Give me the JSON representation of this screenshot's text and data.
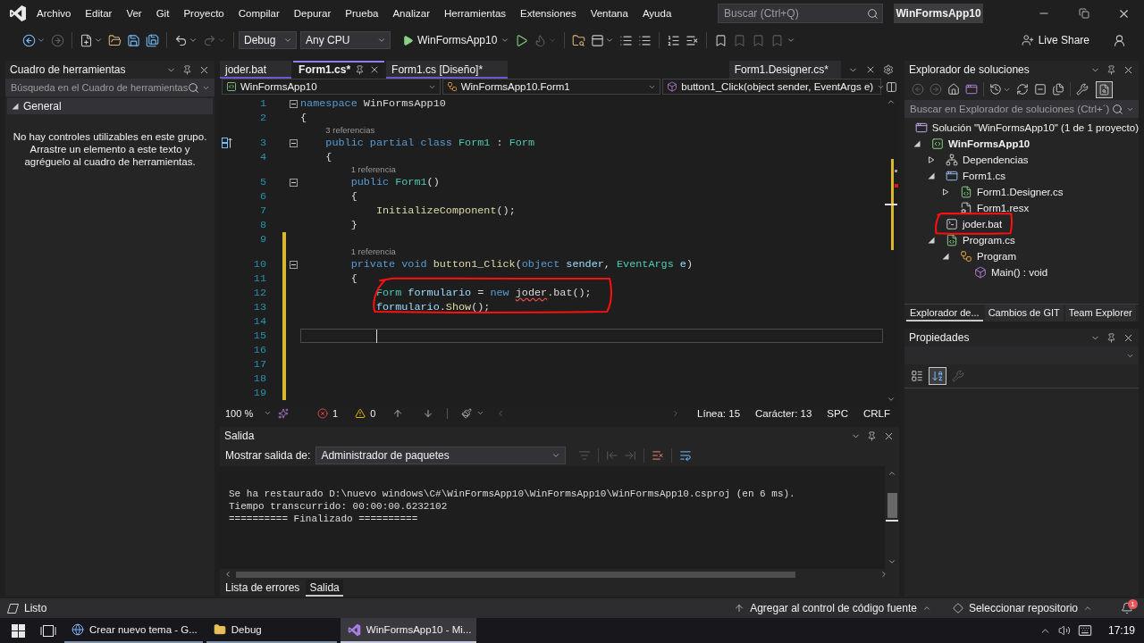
{
  "menu_bar": {
    "items": [
      "Archivo",
      "Editar",
      "Ver",
      "Git",
      "Proyecto",
      "Compilar",
      "Depurar",
      "Prueba",
      "Analizar",
      "Herramientas",
      "Extensiones",
      "Ventana",
      "Ayuda"
    ],
    "search": {
      "placeholder": "Buscar (Ctrl+Q)"
    },
    "solution_name": "WinFormsApp10"
  },
  "toolbar": {
    "items": [
      {
        "kind": "back",
        "disabled": false
      },
      {
        "kind": "forward",
        "disabled": true
      },
      {
        "kind": "separator"
      },
      {
        "kind": "new_item",
        "disabled": false
      },
      {
        "kind": "open",
        "disabled": false
      },
      {
        "kind": "save",
        "disabled": false
      },
      {
        "kind": "save_all",
        "disabled": false
      },
      {
        "kind": "separator"
      },
      {
        "kind": "undo",
        "disabled": false
      },
      {
        "kind": "redo",
        "disabled": true
      },
      {
        "kind": "separator"
      },
      {
        "kind": "dropdown",
        "label": "Debug"
      },
      {
        "kind": "dropdown",
        "label": "Any CPU"
      },
      {
        "kind": "start",
        "label": "WinFormsApp10"
      },
      {
        "kind": "run",
        "disabled": false
      },
      {
        "kind": "hot_reload",
        "disabled": true
      },
      {
        "kind": "separator"
      },
      {
        "kind": "folder_search",
        "disabled": false
      },
      {
        "kind": "layout",
        "disabled": false
      },
      {
        "kind": "align",
        "disabled": false
      },
      {
        "kind": "align",
        "disabled": false
      },
      {
        "kind": "separator"
      },
      {
        "kind": "comment",
        "disabled": false
      },
      {
        "kind": "uncomment",
        "disabled": false
      },
      {
        "kind": "separator"
      },
      {
        "kind": "bookmark",
        "disabled": false
      },
      {
        "kind": "bookmark",
        "disabled": true
      },
      {
        "kind": "bookmark",
        "disabled": true
      },
      {
        "kind": "bookmark",
        "disabled": true
      }
    ],
    "live_share": "Live Share"
  },
  "toolbox": {
    "title": "Cuadro de herramientas",
    "search": {
      "placeholder": "Búsqueda en el Cuadro de herramientas"
    },
    "groups": [
      {
        "label": "General",
        "expanded": true,
        "message": "No hay controles utilizables en este grupo. Arrastre un elemento a este texto y agréguelo al cuadro de herramientas."
      }
    ]
  },
  "editor": {
    "tabs": [
      {
        "label": "joder.bat",
        "selected": false
      },
      {
        "label": "Form1.cs*",
        "selected": true
      },
      {
        "label": "Form1.cs [Diseño]*",
        "selected": false
      }
    ],
    "preview_tab": {
      "label": "Form1.Designer.cs*"
    },
    "navigation": [
      {
        "kind": "project",
        "label": "WinFormsApp10"
      },
      {
        "kind": "class",
        "label": "WinFormsApp10.Form1"
      },
      {
        "kind": "method",
        "label": "button1_Click(object sender, EventArgs e)"
      }
    ],
    "lines": [
      {
        "number": "1",
        "kind": "namespace",
        "tokens": [
          {
            "text": "namespace",
            "kind": "keyword"
          },
          {
            "text": " WinFormsApp10",
            "kind": "plain"
          }
        ],
        "changed": false,
        "current": false,
        "circled": false
      },
      {
        "number": "2",
        "kind": "line",
        "tokens": [
          {
            "text": "{",
            "kind": "plain"
          }
        ],
        "changed": false,
        "current": false,
        "circled": false,
        "children": [
          {
            "number": "3",
            "kind": "class",
            "codelens": "3 referencias",
            "tokens": [
              {
                "text": "public partial class ",
                "kind": "keyword"
              },
              {
                "text": "Form1",
                "kind": "type"
              },
              {
                "text": " : ",
                "kind": "plain"
              },
              {
                "text": "Form",
                "kind": "type"
              }
            ],
            "changed": false,
            "current": false,
            "circled": false
          },
          {
            "number": "4",
            "kind": "line",
            "tokens": [
              {
                "text": "{",
                "kind": "plain"
              }
            ],
            "changed": false,
            "current": false,
            "circled": false,
            "children": [
              {
                "number": "5",
                "kind": "member",
                "codelens": "1 referencia",
                "tokens": [
                  {
                    "text": "public ",
                    "kind": "keyword"
                  },
                  {
                    "text": "Form1",
                    "kind": "type"
                  },
                  {
                    "text": "()",
                    "kind": "plain"
                  }
                ],
                "changed": false,
                "current": false,
                "circled": false
              },
              {
                "number": "6",
                "kind": "line",
                "tokens": [
                  {
                    "text": "{",
                    "kind": "plain"
                  }
                ],
                "changed": false,
                "current": false,
                "circled": false,
                "children": [
                  {
                    "number": "7",
                    "kind": "line",
                    "tokens": [
                      {
                        "text": "InitializeComponent",
                        "kind": "method"
                      },
                      {
                        "text": "();",
                        "kind": "plain"
                      }
                    ],
                    "changed": false,
                    "current": false,
                    "circled": false
                  }
                ]
              },
              {
                "number": "8",
                "kind": "line",
                "tokens": [
                  {
                    "text": "}",
                    "kind": "plain"
                  }
                ],
                "changed": false,
                "current": false,
                "circled": false
              },
              {
                "number": "9",
                "kind": "line",
                "changed": true,
                "current": false,
                "circled": false
              },
              {
                "number": "10",
                "kind": "member",
                "codelens": "1 referencia",
                "tokens": [
                  {
                    "text": "private void ",
                    "kind": "keyword"
                  },
                  {
                    "text": "button1_Click",
                    "kind": "method"
                  },
                  {
                    "text": "(",
                    "kind": "plain"
                  },
                  {
                    "text": "object",
                    "kind": "keyword"
                  },
                  {
                    "text": " sender",
                    "kind": "param"
                  },
                  {
                    "text": ", ",
                    "kind": "plain"
                  },
                  {
                    "text": "EventArgs",
                    "kind": "type"
                  },
                  {
                    "text": " e",
                    "kind": "param"
                  },
                  {
                    "text": ")",
                    "kind": "plain"
                  }
                ],
                "changed": true,
                "current": false,
                "circled": false
              },
              {
                "number": "11",
                "kind": "line",
                "tokens": [
                  {
                    "text": "{",
                    "kind": "plain"
                  }
                ],
                "changed": true,
                "current": false,
                "circled": false,
                "children": [
                  {
                    "number": "12",
                    "kind": "line",
                    "tokens": [
                      {
                        "text": "Form",
                        "kind": "type"
                      },
                      {
                        "text": " formulario",
                        "kind": "param"
                      },
                      {
                        "text": " = ",
                        "kind": "plain"
                      },
                      {
                        "text": "new ",
                        "kind": "keyword"
                      },
                      {
                        "text": "joder",
                        "kind": "unresolved"
                      },
                      {
                        "text": ".bat();",
                        "kind": "plain"
                      }
                    ],
                    "changed": true,
                    "current": false,
                    "circled": true
                  },
                  {
                    "number": "13",
                    "kind": "line",
                    "tokens": [
                      {
                        "text": "formulario",
                        "kind": "param"
                      },
                      {
                        "text": ".",
                        "kind": "plain"
                      },
                      {
                        "text": "Show",
                        "kind": "method"
                      },
                      {
                        "text": "();",
                        "kind": "plain"
                      }
                    ],
                    "changed": true,
                    "current": false,
                    "circled": true
                  },
                  {
                    "number": "14",
                    "kind": "line",
                    "changed": true,
                    "current": false,
                    "circled": false
                  },
                  {
                    "number": "15",
                    "kind": "line",
                    "changed": true,
                    "current": true,
                    "circled": false
                  },
                  {
                    "number": "16",
                    "kind": "line",
                    "changed": true,
                    "current": false,
                    "circled": false
                  },
                  {
                    "number": "17",
                    "kind": "line",
                    "changed": true,
                    "current": false,
                    "circled": false
                  },
                  {
                    "number": "18",
                    "kind": "line",
                    "changed": true,
                    "current": false,
                    "circled": false
                  },
                  {
                    "number": "19",
                    "kind": "line",
                    "changed": true,
                    "current": false,
                    "circled": false
                  }
                ]
              }
            ]
          }
        ]
      }
    ],
    "status": {
      "zoom": "100 %",
      "errors": "1",
      "warnings": "0",
      "line": "Línea: 15",
      "column": "Carácter: 13",
      "whitespace": "SPC",
      "line_ending": "CRLF"
    }
  },
  "output": {
    "title": "Salida",
    "source_label": "Mostrar salida de:",
    "source": "Administrador de paquetes",
    "toolbar": [
      {
        "kind": "find",
        "disabled": true
      },
      {
        "kind": "separator"
      },
      {
        "kind": "previous",
        "disabled": true
      },
      {
        "kind": "next",
        "disabled": true
      },
      {
        "kind": "separator"
      },
      {
        "kind": "clear",
        "disabled": false
      },
      {
        "kind": "separator"
      },
      {
        "kind": "word_wrap",
        "disabled": false
      }
    ],
    "lines": [
      "Se ha restaurado D:\\nuevo windows\\C#\\WinFormsApp10\\WinFormsApp10\\WinFormsApp10.csproj (en 6 ms).",
      "Tiempo transcurrido: 00:00:00.6232102",
      "========== Finalizado =========="
    ],
    "tabs": [
      {
        "label": "Lista de errores",
        "selected": false
      },
      {
        "label": "Salida",
        "selected": true
      }
    ]
  },
  "solution_explorer": {
    "title": "Explorador de soluciones",
    "toolbar": [
      {
        "kind": "back",
        "disabled": true
      },
      {
        "kind": "forward",
        "disabled": true
      },
      {
        "kind": "home",
        "disabled": false
      },
      {
        "kind": "switch_views",
        "disabled": false
      },
      {
        "kind": "separator"
      },
      {
        "kind": "history",
        "disabled": false
      },
      {
        "kind": "sync",
        "disabled": false
      },
      {
        "kind": "collapse",
        "disabled": false
      },
      {
        "kind": "show_all",
        "disabled": false
      },
      {
        "kind": "separator"
      },
      {
        "kind": "properties",
        "disabled": false
      }
    ],
    "toolbar_toggle": {
      "on": true
    },
    "search": {
      "placeholder": "Buscar en Explorador de soluciones (Ctrl+´)"
    },
    "tree": [
      {
        "label": "Solución \"WinFormsApp10\" (1 de 1 proyecto)",
        "kind": "solution",
        "circled": false,
        "children": [
          {
            "label": "WinFormsApp10",
            "kind": "project",
            "expanded": true,
            "circled": false,
            "children": [
              {
                "label": "Dependencias",
                "kind": "dependencies",
                "expanded": false,
                "circled": false
              },
              {
                "label": "Form1.cs",
                "kind": "form",
                "expanded": true,
                "circled": false,
                "children": [
                  {
                    "label": "Form1.Designer.cs",
                    "kind": "csharp",
                    "expanded": false,
                    "circled": false
                  },
                  {
                    "label": "Form1.resx",
                    "kind": "resource",
                    "circled": false
                  }
                ]
              },
              {
                "label": "joder.bat",
                "kind": "batch",
                "circled": true
              },
              {
                "label": "Program.cs",
                "kind": "csharp",
                "expanded": true,
                "circled": false,
                "children": [
                  {
                    "label": "Program",
                    "kind": "class",
                    "expanded": true,
                    "circled": false,
                    "children": [
                      {
                        "label": "Main() : void",
                        "kind": "method",
                        "circled": false
                      }
                    ]
                  }
                ]
              }
            ]
          }
        ]
      }
    ],
    "tabs": [
      {
        "label": "Explorador de...",
        "selected": true
      },
      {
        "label": "Cambios de GIT",
        "selected": false
      },
      {
        "label": "Team Explorer",
        "selected": false
      }
    ]
  },
  "properties": {
    "title": "Propiedades",
    "buttons": [
      {
        "kind": "categorized",
        "selected": false,
        "disabled": false
      },
      {
        "kind": "alphabetical",
        "selected": true,
        "disabled": false
      },
      {
        "kind": "property_pages",
        "selected": false,
        "disabled": true
      }
    ]
  },
  "status_bar": {
    "text": "Listo",
    "source_control": "Agregar al control de código fuente",
    "repository": "Seleccionar repositorio",
    "notifications": "1"
  },
  "taskbar": {
    "apps": [
      {
        "label": "Crear nuevo tema - G...",
        "kind": "browser",
        "selected": false
      },
      {
        "label": "Debug",
        "kind": "folder",
        "selected": false
      },
      {
        "label": "WinFormsApp10 - Mi...",
        "kind": "ide",
        "selected": true
      }
    ],
    "time": "17:19"
  }
}
